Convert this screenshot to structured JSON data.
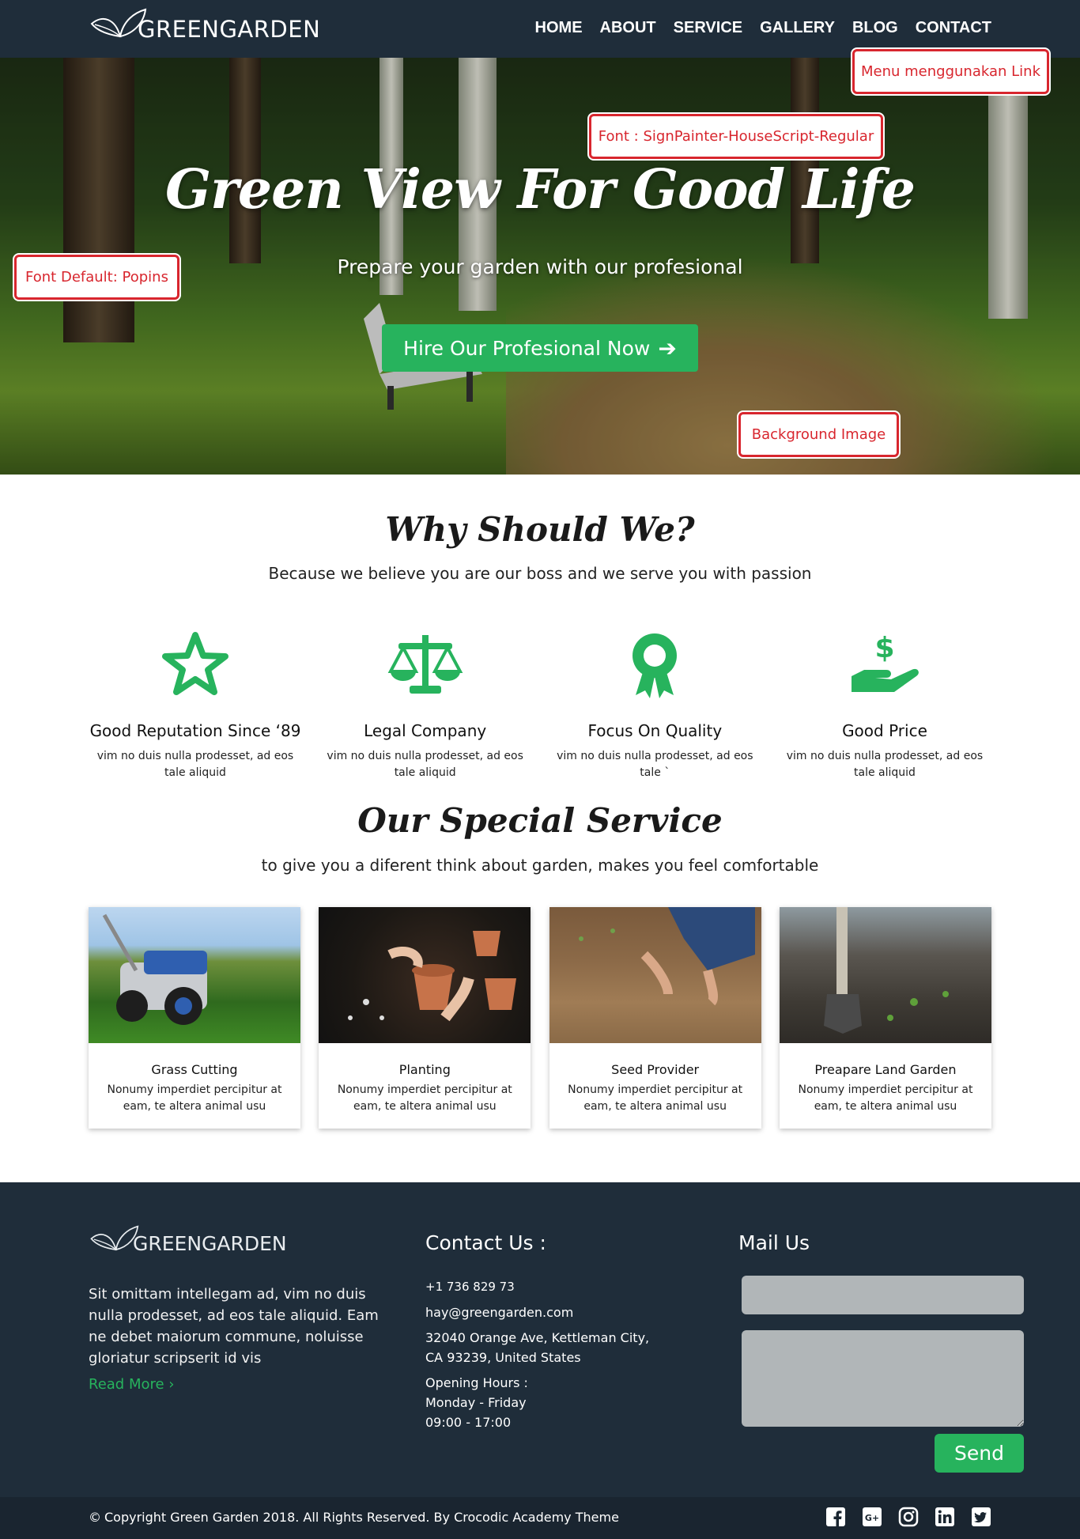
{
  "nav": {
    "brand": "GREENGARDEN",
    "menu": [
      "HOME",
      "ABOUT",
      "SERVICE",
      "GALLERY",
      "BLOG",
      "CONTACT"
    ]
  },
  "hero": {
    "title": "Green View For Good Life",
    "subtitle": "Prepare your garden with our profesional",
    "cta_label": "Hire Our Profesional Now"
  },
  "annotations": {
    "menu": "Menu menggunakan Link",
    "font_script": "Font : SignPainter-HouseScript-Regular",
    "font_default": "Font Default: Popins",
    "background": "Background Image"
  },
  "why": {
    "title": "Why Should We?",
    "subtitle": "Because we believe you are our boss and we serve you with passion",
    "features": [
      {
        "icon": "star-icon",
        "title": "Good Reputation Since ‘89",
        "text": "vim no duis nulla prodesset, ad eos tale aliquid"
      },
      {
        "icon": "scale-icon",
        "title": "Legal Company",
        "text": "vim no duis nulla prodesset, ad eos tale aliquid"
      },
      {
        "icon": "award-icon",
        "title": "Focus On Quality",
        "text": "vim no duis nulla prodesset, ad eos tale `"
      },
      {
        "icon": "hand-dollar-icon",
        "title": "Good Price",
        "text": "vim no duis nulla prodesset, ad eos tale aliquid"
      }
    ]
  },
  "services": {
    "title": "Our Special Service",
    "subtitle": "to give you a diferent think about garden, makes you feel comfortable",
    "cards": [
      {
        "title": "Grass Cutting",
        "text": "Nonumy imperdiet percipitur at eam, te altera animal usu"
      },
      {
        "title": "Planting",
        "text": "Nonumy imperdiet percipitur at eam, te altera animal usu"
      },
      {
        "title": "Seed Provider",
        "text": "Nonumy imperdiet percipitur at eam, te altera animal usu"
      },
      {
        "title": "Preapare Land Garden",
        "text": "Nonumy imperdiet percipitur at eam, te altera animal usu"
      }
    ]
  },
  "footer": {
    "brand": "GREENGARDEN",
    "about": "Sit omittam intellegam ad, vim no duis nulla prodesset, ad eos tale aliquid. Eam ne debet maiorum commune, noluisse gloriatur scripserit id vis",
    "read_more": "Read More ›",
    "contact_heading": "Contact Us :",
    "phone": "+1 736 829 73",
    "email": "hay@greengarden.com",
    "address_line1": "32040 Orange Ave, Kettleman City,",
    "address_line2": "CA 93239, United States",
    "hours_label": "Opening Hours :",
    "hours_days": "Monday - Friday",
    "hours_time": "09:00 - 17:00",
    "mail_heading": "Mail Us",
    "send_label": "Send",
    "copyright": "Copyright Green Garden 2018. All Rights Reserved. By Crocodic Academy Theme"
  },
  "colors": {
    "accent": "#27b35d",
    "dark": "#1f2d3a",
    "annotation": "#d8262e"
  }
}
